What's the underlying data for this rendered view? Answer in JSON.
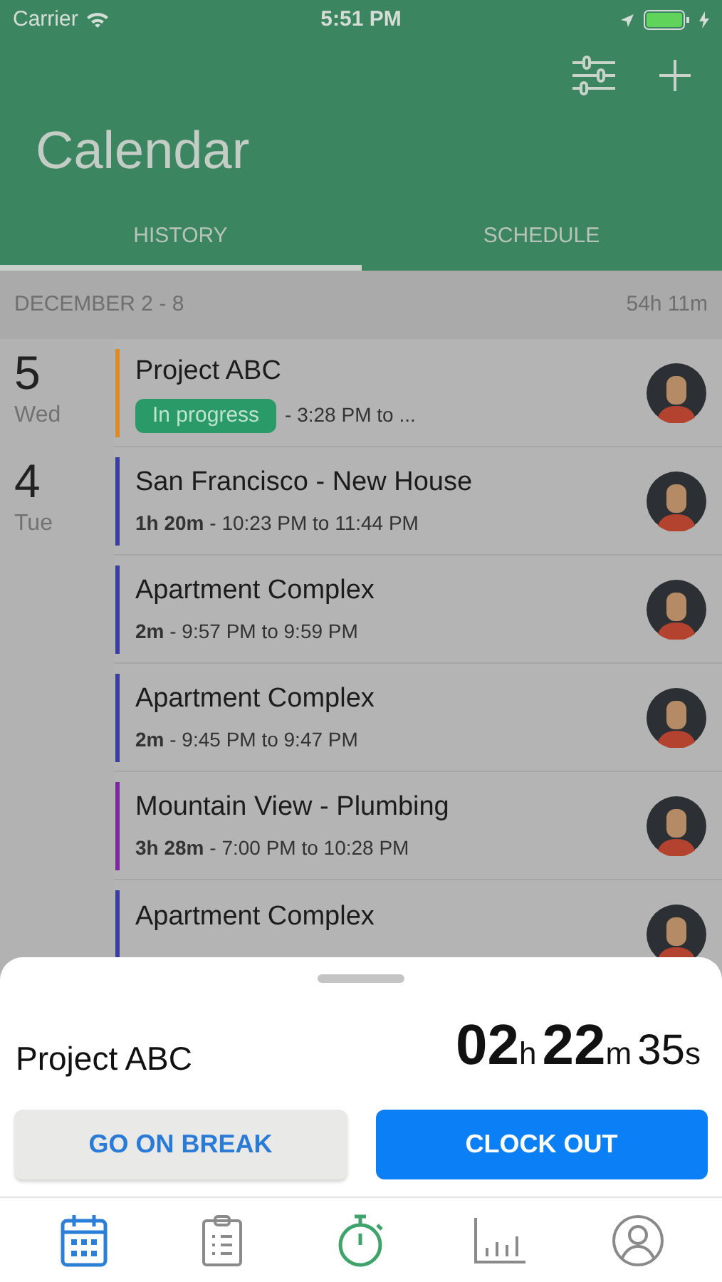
{
  "status_bar": {
    "carrier": "Carrier",
    "time": "5:51 PM"
  },
  "header": {
    "title": "Calendar"
  },
  "tabs": [
    {
      "label": "HISTORY",
      "selected": true
    },
    {
      "label": "SCHEDULE",
      "selected": false
    }
  ],
  "week": {
    "range": "DECEMBER 2 - 8",
    "total": "54h 11m"
  },
  "days": [
    {
      "day": "5",
      "weekday": "Wed",
      "entries": [
        {
          "kind": "in_progress",
          "title": "Project ABC",
          "badge": "In progress",
          "time": "- 3:28 PM to ...",
          "color": "#d98a2b"
        }
      ]
    },
    {
      "day": "4",
      "weekday": "Tue",
      "entries": [
        {
          "kind": "completed",
          "title": "San Francisco - New House",
          "duration": "1h 20m",
          "time": "- 10:23 PM to 11:44 PM",
          "color": "#3a3f9e"
        },
        {
          "kind": "completed",
          "title": "Apartment Complex",
          "duration": "2m",
          "time": "- 9:57 PM to 9:59 PM",
          "color": "#3a3f9e"
        },
        {
          "kind": "completed",
          "title": "Apartment Complex",
          "duration": "2m",
          "time": "- 9:45 PM to 9:47 PM",
          "color": "#3a3f9e"
        },
        {
          "kind": "completed",
          "title": "Mountain View - Plumbing",
          "duration": "3h 28m",
          "time": "- 7:00 PM to 10:28 PM",
          "color": "#7b2a9e"
        },
        {
          "kind": "completed",
          "title": "Apartment Complex",
          "color": "#3a3f9e"
        }
      ]
    }
  ],
  "sheet": {
    "project": "Project ABC",
    "timer": [
      {
        "value": "02",
        "unit": "h"
      },
      {
        "value": "22",
        "unit": "m"
      },
      {
        "value": "35",
        "unit": "s"
      }
    ],
    "buttons": [
      {
        "label": "GO ON BREAK",
        "kind": "secondary"
      },
      {
        "label": "CLOCK OUT",
        "kind": "primary"
      }
    ]
  },
  "tab_bar": [
    {
      "kind": "calendar",
      "selected": true
    },
    {
      "kind": "checklist",
      "selected": false
    },
    {
      "kind": "timer",
      "selected": false
    },
    {
      "kind": "chart",
      "selected": false
    },
    {
      "kind": "profile",
      "selected": false
    }
  ]
}
